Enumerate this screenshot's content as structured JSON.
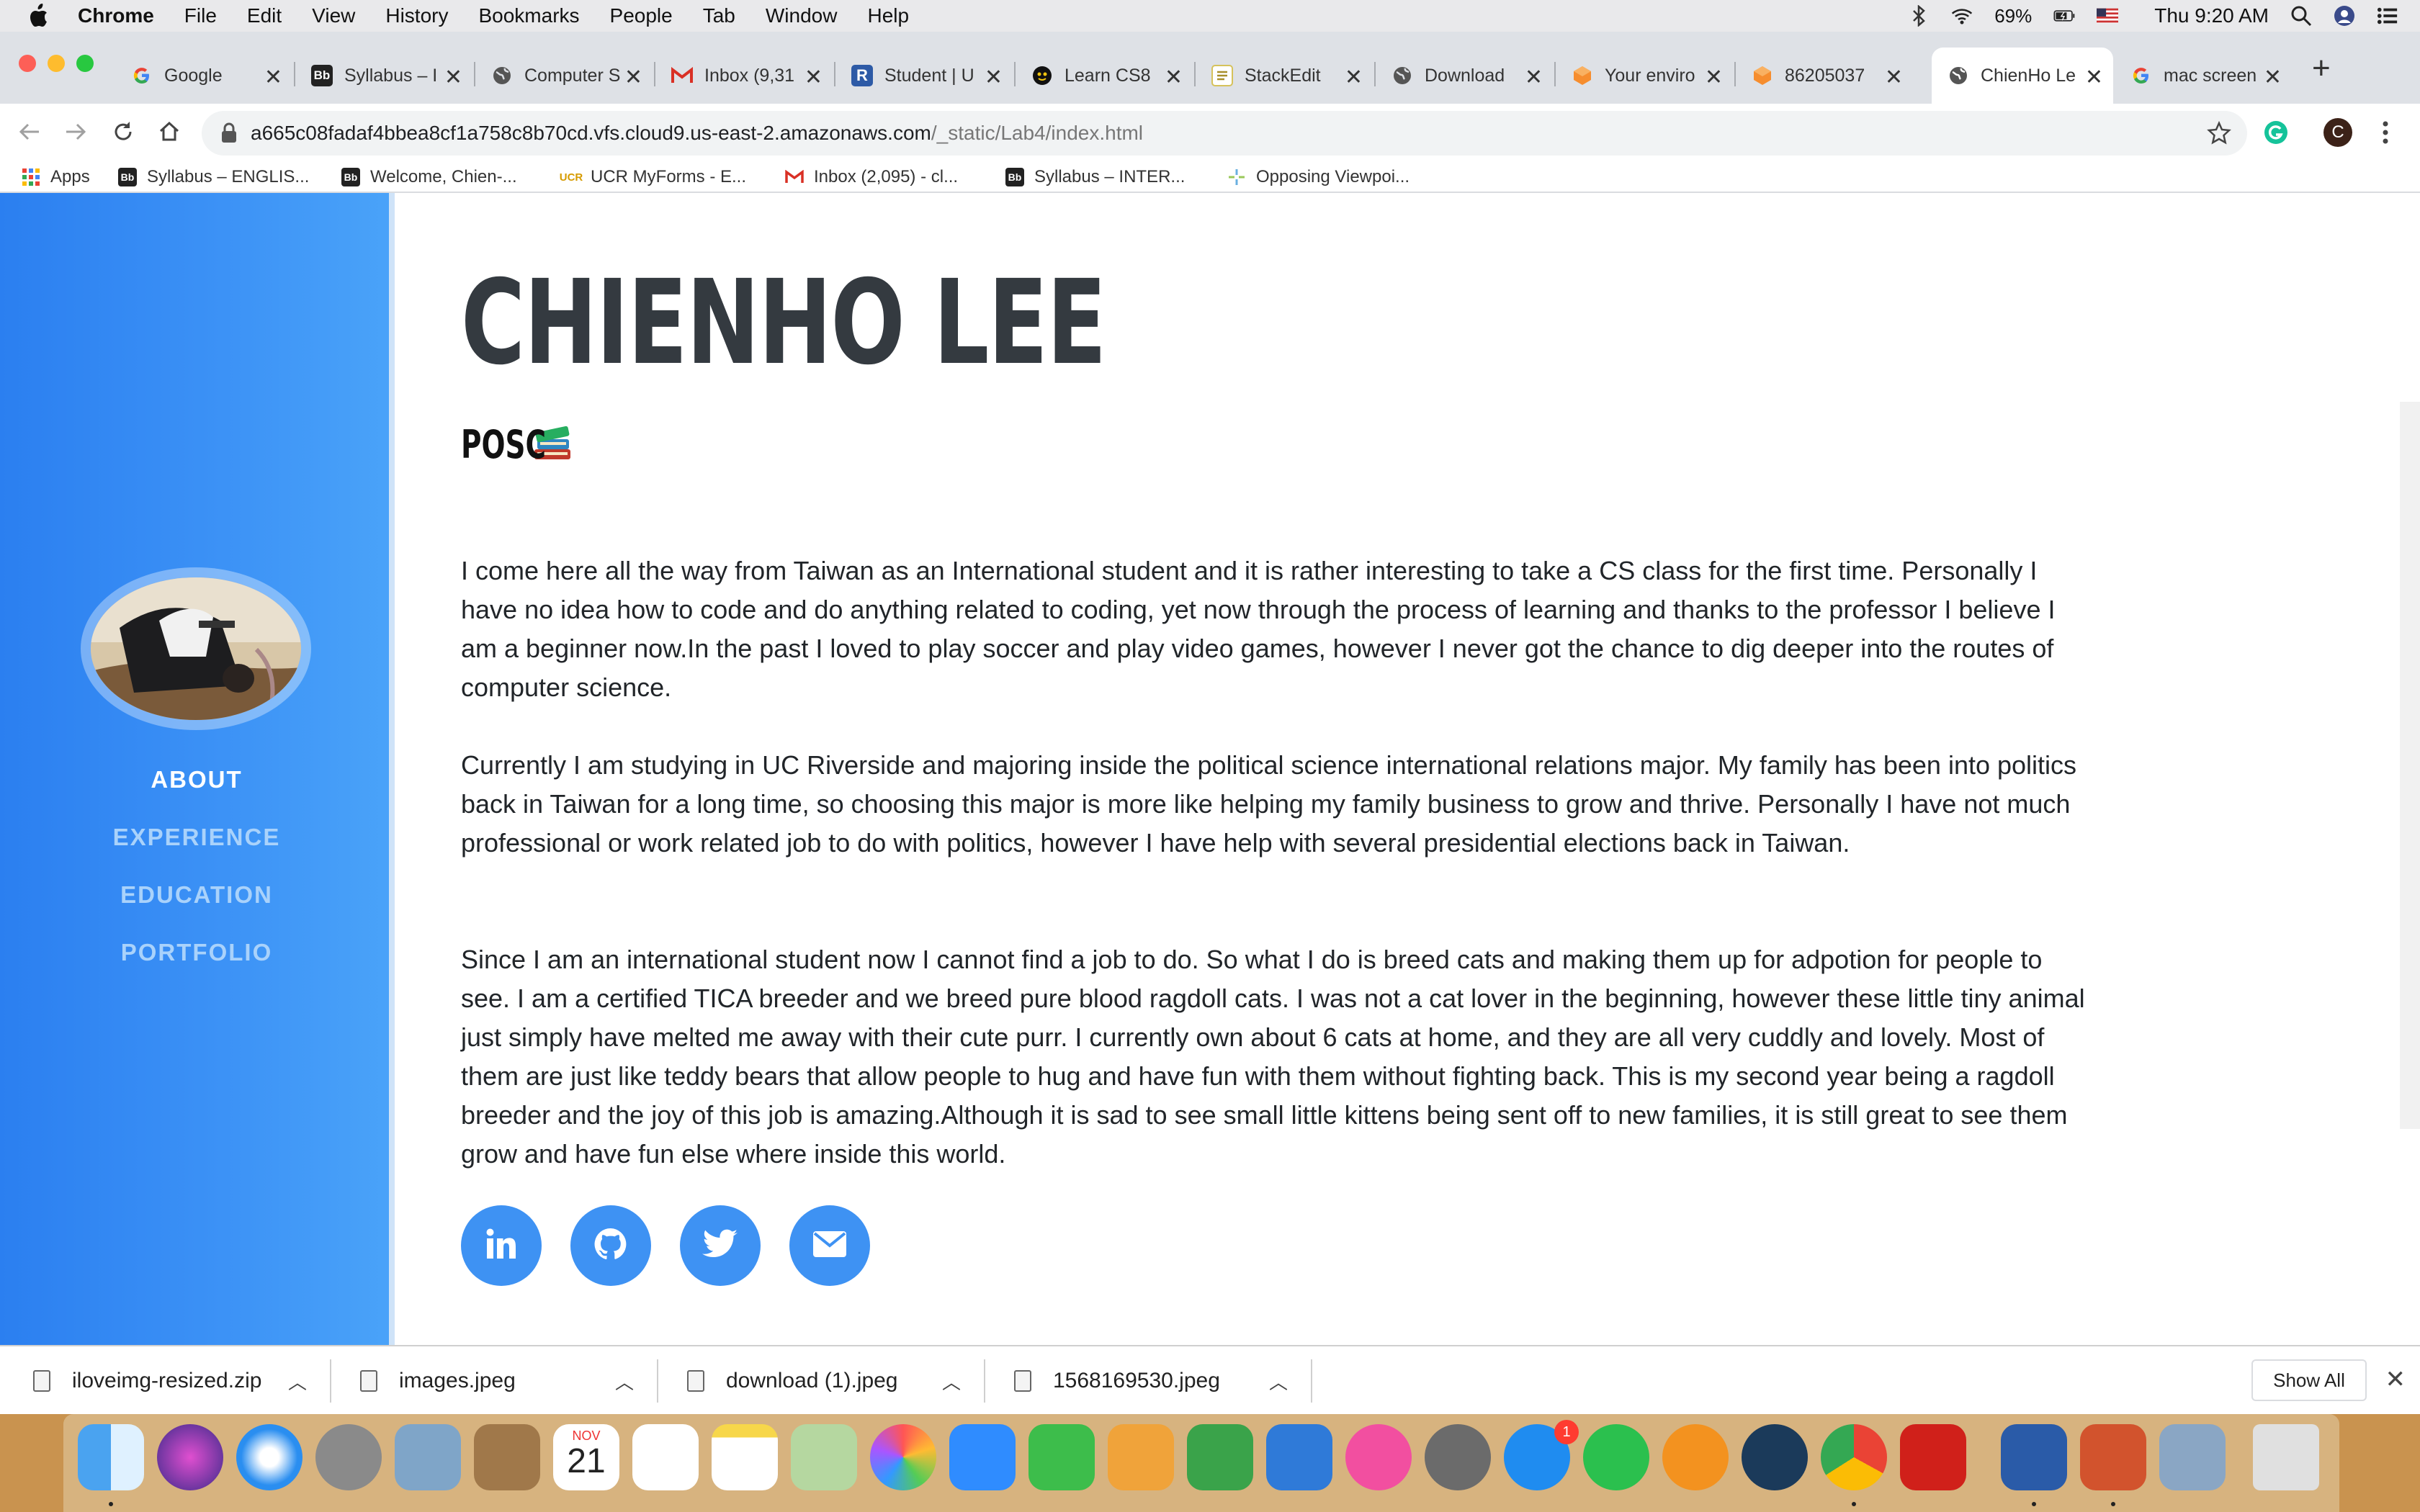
{
  "menubar": {
    "app_name": "Chrome",
    "menus": [
      "File",
      "Edit",
      "View",
      "History",
      "Bookmarks",
      "People",
      "Tab",
      "Window",
      "Help"
    ],
    "battery": "69%",
    "clock": "Thu 9:20 AM"
  },
  "tabs": [
    {
      "label": "Google",
      "icon": "google-icon"
    },
    {
      "label": "Syllabus – I",
      "icon": "blackboard-icon"
    },
    {
      "label": "Computer S",
      "icon": "globe-icon"
    },
    {
      "label": "Inbox (9,31",
      "icon": "gmail-icon"
    },
    {
      "label": "Student | U",
      "icon": "r-icon"
    },
    {
      "label": "Learn CS8",
      "icon": "github-icon"
    },
    {
      "label": "StackEdit",
      "icon": "stackedit-icon"
    },
    {
      "label": "Download",
      "icon": "globe-icon"
    },
    {
      "label": "Your enviro",
      "icon": "cloud9-icon"
    },
    {
      "label": "86205037",
      "icon": "cloud9-icon"
    },
    {
      "label": "ChienHo Le",
      "icon": "globe-icon",
      "active": true
    },
    {
      "label": "mac screen",
      "icon": "google-icon"
    }
  ],
  "toolbar": {
    "url_host": "a665c08fadaf4bbea8cf1a758c8b70cd.vfs.cloud9.us-east-2.amazonaws.com",
    "url_path": "/_static/Lab4/index.html",
    "profile_initial": "C"
  },
  "bookmarks": [
    {
      "label": "Apps",
      "icon": "apps-grid-icon"
    },
    {
      "label": "Syllabus – ENGLIS...",
      "icon": "blackboard-icon"
    },
    {
      "label": "Welcome, Chien-...",
      "icon": "blackboard-icon"
    },
    {
      "label": "UCR MyForms - E...",
      "icon": "ucr-icon"
    },
    {
      "label": "Inbox (2,095) - cl...",
      "icon": "gmail-icon"
    },
    {
      "label": "Syllabus – INTER...",
      "icon": "blackboard-icon"
    },
    {
      "label": "Opposing Viewpoi...",
      "icon": "pinwheel-icon"
    }
  ],
  "sidebar": {
    "nav": [
      "ABOUT",
      "EXPERIENCE",
      "EDUCATION",
      "PORTFOLIO"
    ],
    "active": "ABOUT"
  },
  "main": {
    "name": "CHIENHO LEE",
    "subtitle": "POSC",
    "paragraphs": [
      "I come here all the way from Taiwan as an International student and it is rather interesting to take a CS class for the first time. Personally I have no idea how to code and do anything related to coding, yet now through the process of learning and thanks to the professor I believe I am a beginner now.In the past I loved to play soccer and play video games, however I never got the chance to dig deeper into the routes of computer science.",
      "Currently I am studying in UC Riverside and majoring inside the political science international relations major. My family has been into politics back in Taiwan for a long time, so choosing this major is more like helping my family business to grow and thrive. Personally I have not much professional or work related job to do with politics, however I have help with several presidential elections back in Taiwan.",
      "Since I am an international student now I cannot find a job to do. So what I do is breed cats and making them up for adpotion for people to see. I am a certified TICA breeder and we breed pure blood ragdoll cats. I was not a cat lover in the beginning, however these little tiny animal just simply have melted me away with their cute purr. I currently own about 6 cats at home, and they are all very cuddly and lovely. Most of them are just like teddy bears that allow people to hug and have fun with them without fighting back. This is my second year being a ragdoll breeder and the joy of this job is amazing.Although it is sad to see small little kittens being sent off to new families, it is still great to see them grow and have fun else where inside this world."
    ],
    "social": [
      "linkedin-icon",
      "github-icon",
      "twitter-icon",
      "envelope-icon"
    ]
  },
  "downloads": {
    "files": [
      "iloveimg-resized.zip",
      "images.jpeg",
      "download (1).jpeg",
      "1568169530.jpeg"
    ],
    "show_all": "Show All"
  },
  "dock": {
    "calendar_month": "NOV",
    "calendar_day": "21",
    "appstore_badge": "1"
  },
  "colors": {
    "sidebar_blue": "#3d93f6",
    "nav_active": "#ffffff",
    "nav_inactive": "#a9d2fb",
    "name_text": "#343a40",
    "social_blue": "#3e92f3"
  }
}
